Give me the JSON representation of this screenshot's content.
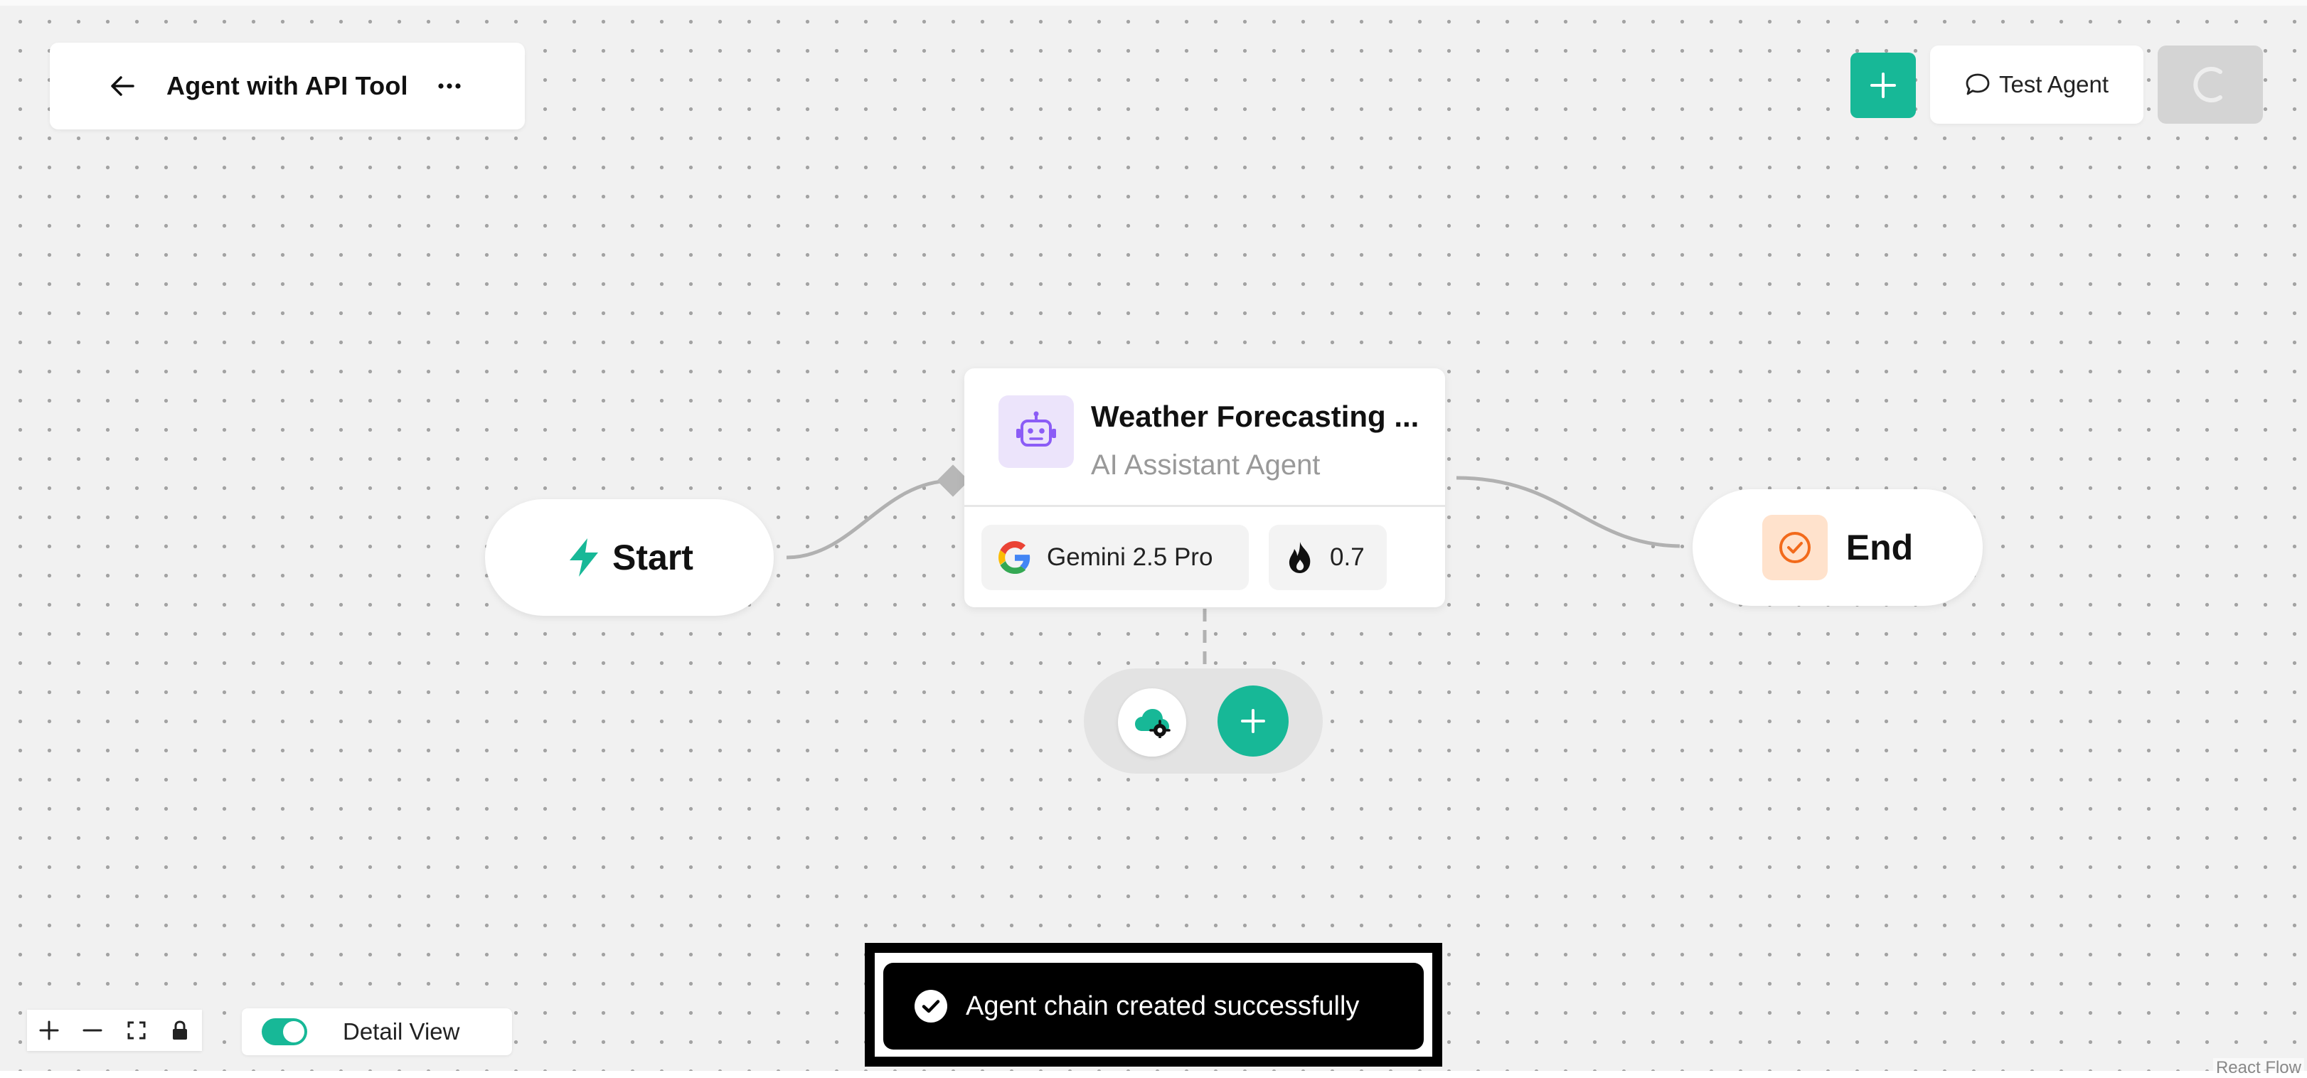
{
  "header": {
    "title": "Agent with API Tool",
    "back_icon": "arrow-left-icon",
    "more_icon": "more-horizontal-icon"
  },
  "toolbar": {
    "add_icon": "plus-icon",
    "test_agent_label": "Test Agent",
    "test_agent_icon": "chat-bubble-icon",
    "loading_icon": "spinner-icon"
  },
  "nodes": {
    "start": {
      "label": "Start",
      "icon": "lightning-icon"
    },
    "agent": {
      "title": "Weather Forecasting ...",
      "subtitle": "AI Assistant Agent",
      "icon": "robot-icon",
      "model": "Gemini 2.5 Pro",
      "model_icon": "google-g-icon",
      "temperature": "0.7",
      "temperature_icon": "flame-icon",
      "tools": [
        {
          "icon": "cloud-gear-icon"
        }
      ],
      "add_tool_icon": "plus-icon"
    },
    "end": {
      "label": "End",
      "icon": "check-circle-icon"
    }
  },
  "controls": {
    "zoom_in_icon": "plus-icon",
    "zoom_out_icon": "minus-icon",
    "fit_view_icon": "fit-view-icon",
    "lock_icon": "lock-icon"
  },
  "detail_view": {
    "label": "Detail View",
    "enabled": true
  },
  "toast": {
    "message": "Agent chain created successfully",
    "icon": "check-circle-icon"
  },
  "attribution": "React Flow",
  "colors": {
    "accent": "#17b897",
    "agent_icon_bg": "#ece4fb",
    "agent_icon": "#8b5cf6",
    "end_icon_bg": "#ffe2cc",
    "end_icon": "#f26a1b",
    "canvas": "#f1f1f1"
  }
}
